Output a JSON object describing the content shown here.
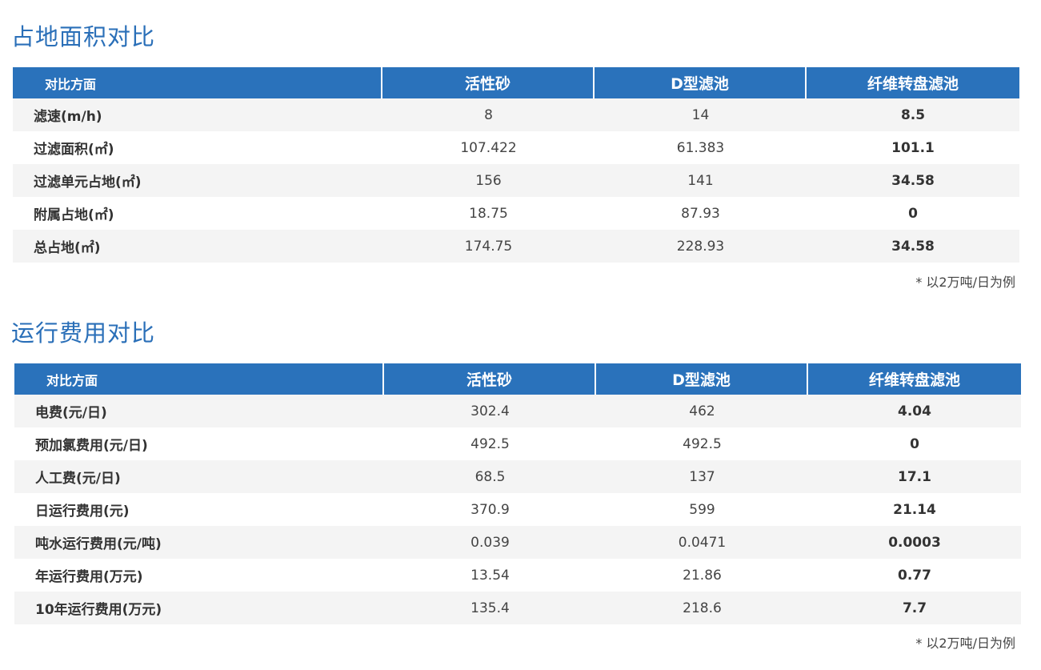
{
  "sections": [
    {
      "title": "占地面积对比",
      "headers": [
        "对比方面",
        "活性砂",
        "D型滤池",
        "纤维转盘滤池"
      ],
      "rows": [
        {
          "label": "滤速(m/h)",
          "values": [
            "8",
            "14",
            "8.5"
          ]
        },
        {
          "label": "过滤面积(㎡)",
          "values": [
            "107.422",
            "61.383",
            "101.1"
          ]
        },
        {
          "label": "过滤单元占地(㎡)",
          "values": [
            "156",
            "141",
            "34.58"
          ]
        },
        {
          "label": "附属占地(㎡)",
          "values": [
            "18.75",
            "87.93",
            "0"
          ]
        },
        {
          "label": "总占地(㎡)",
          "values": [
            "174.75",
            "228.93",
            "34.58"
          ]
        }
      ],
      "note": "* 以2万吨/日为例"
    },
    {
      "title": "运行费用对比",
      "headers": [
        "对比方面",
        "活性砂",
        "D型滤池",
        "纤维转盘滤池"
      ],
      "rows": [
        {
          "label": "电费(元/日)",
          "values": [
            "302.4",
            "462",
            "4.04"
          ]
        },
        {
          "label": "预加氯费用(元/日)",
          "values": [
            "492.5",
            "492.5",
            "0"
          ]
        },
        {
          "label": "人工费(元/日)",
          "values": [
            "68.5",
            "137",
            "17.1"
          ]
        },
        {
          "label": "日运行费用(元)",
          "values": [
            "370.9",
            "599",
            "21.14"
          ]
        },
        {
          "label": "吨水运行费用(元/吨)",
          "values": [
            "0.039",
            "0.0471",
            "0.0003"
          ]
        },
        {
          "label": "年运行费用(万元)",
          "values": [
            "13.54",
            "21.86",
            "0.77"
          ]
        },
        {
          "label": "10年运行费用(万元)",
          "values": [
            "135.4",
            "218.6",
            "7.7"
          ]
        }
      ],
      "note": "* 以2万吨/日为例"
    }
  ],
  "colors": {
    "title": "#2a6fb8",
    "header_bg": "#2a72bb",
    "row_alt_bg": "#f4f4f4"
  }
}
